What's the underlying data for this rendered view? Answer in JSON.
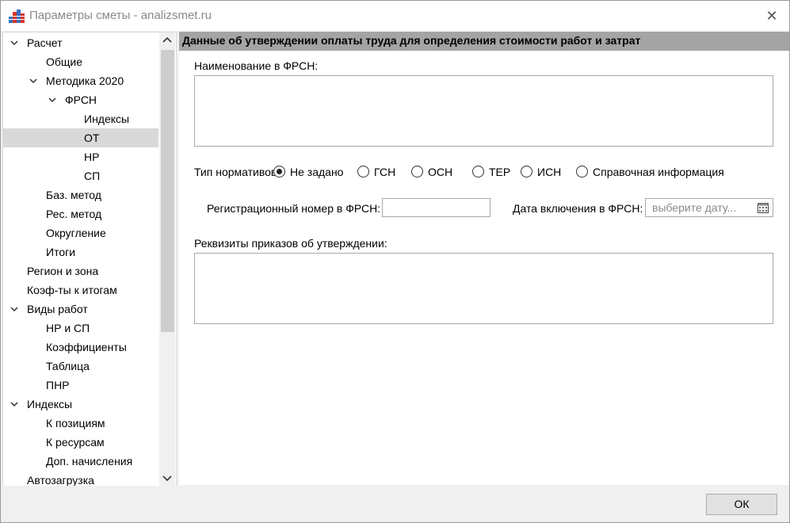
{
  "window": {
    "title": "Параметры сметы - analizsmet.ru",
    "close_glyph": "✕"
  },
  "tree": {
    "items": [
      {
        "label": "Расчет",
        "expanded": true
      },
      {
        "label": "Общие"
      },
      {
        "label": "Методика 2020",
        "expanded": true
      },
      {
        "label": "ФРСН",
        "expanded": true
      },
      {
        "label": "Индексы"
      },
      {
        "label": "ОТ",
        "selected": true
      },
      {
        "label": "НР"
      },
      {
        "label": "СП"
      },
      {
        "label": "Баз. метод"
      },
      {
        "label": "Рес. метод"
      },
      {
        "label": "Округление"
      },
      {
        "label": "Итоги"
      },
      {
        "label": "Регион и зона"
      },
      {
        "label": "Коэф-ты к итогам"
      },
      {
        "label": "Виды работ",
        "expanded": true
      },
      {
        "label": "НР и СП"
      },
      {
        "label": "Коэффициенты"
      },
      {
        "label": "Таблица"
      },
      {
        "label": "ПНР"
      },
      {
        "label": "Индексы",
        "expanded": true
      },
      {
        "label": "К позициям"
      },
      {
        "label": "К ресурсам"
      },
      {
        "label": "Доп. начисления"
      },
      {
        "label": "Автозагрузка"
      }
    ]
  },
  "content": {
    "header": "Данные об утверждении оплаты труда для определения стоимости работ и затрат",
    "name_label": "Наименование в ФРСН:",
    "name_value": "",
    "norm_type_label": "Тип нормативов:",
    "norm_types": [
      {
        "label": "Не задано",
        "checked": true
      },
      {
        "label": "ГСН",
        "checked": false
      },
      {
        "label": "ОСН",
        "checked": false
      },
      {
        "label": "ТЕР",
        "checked": false
      },
      {
        "label": "ИСН",
        "checked": false
      },
      {
        "label": "Справочная информация",
        "checked": false
      }
    ],
    "reg_number_label": "Регистрационный номер в ФРСН:",
    "reg_number_value": "",
    "date_label": "Дата включения в ФРСН:",
    "date_placeholder": "выберите дату...",
    "orders_label": "Реквизиты приказов об утверждении:",
    "orders_value": ""
  },
  "footer": {
    "ok_label": "ОК"
  },
  "icons": {
    "app": "app-grid-icon",
    "close": "close-icon",
    "expand": "chevron-down-icon",
    "calendar": "calendar-icon",
    "scroll_up": "chevron-up-icon",
    "scroll_down": "chevron-down-icon"
  }
}
